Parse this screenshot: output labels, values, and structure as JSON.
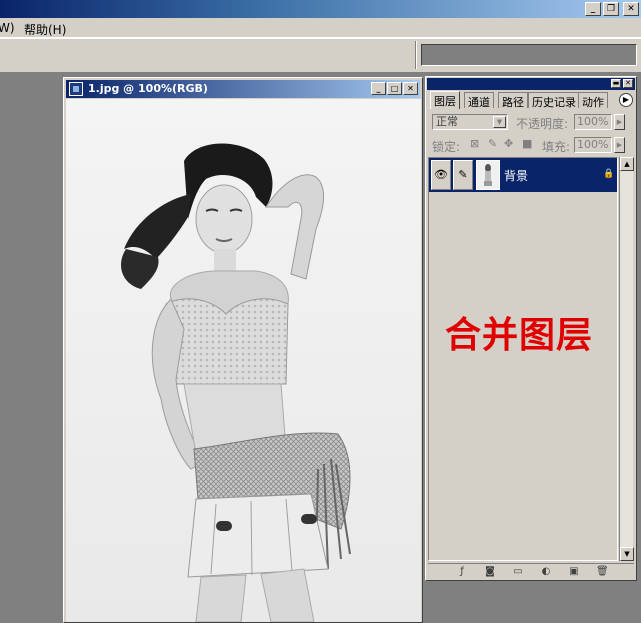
{
  "menubar": {
    "partial_item": "W)",
    "help": "帮助(H)"
  },
  "window_buttons": {
    "minimize": "_",
    "restore": "❐",
    "close": "✕"
  },
  "document": {
    "title": "1.jpg @ 100%(RGB)"
  },
  "layers_palette": {
    "tabs": [
      "图层",
      "通道",
      "路径",
      "历史记录",
      "动作"
    ],
    "blend_mode": "正常",
    "opacity_label": "不透明度:",
    "opacity_value": "100%",
    "lock_label": "锁定:",
    "fill_label": "填充:",
    "fill_value": "100%",
    "layers": [
      {
        "name": "背景",
        "visible": true,
        "locked": true,
        "selected": true
      }
    ]
  },
  "annotation": {
    "text": "合并图层",
    "color": "#e00000"
  },
  "colors": {
    "titlebar_start": "#0a246a",
    "titlebar_end": "#a6caf0",
    "chrome": "#d4d0c8",
    "workspace": "#808080",
    "selected_layer": "#0a246a"
  }
}
